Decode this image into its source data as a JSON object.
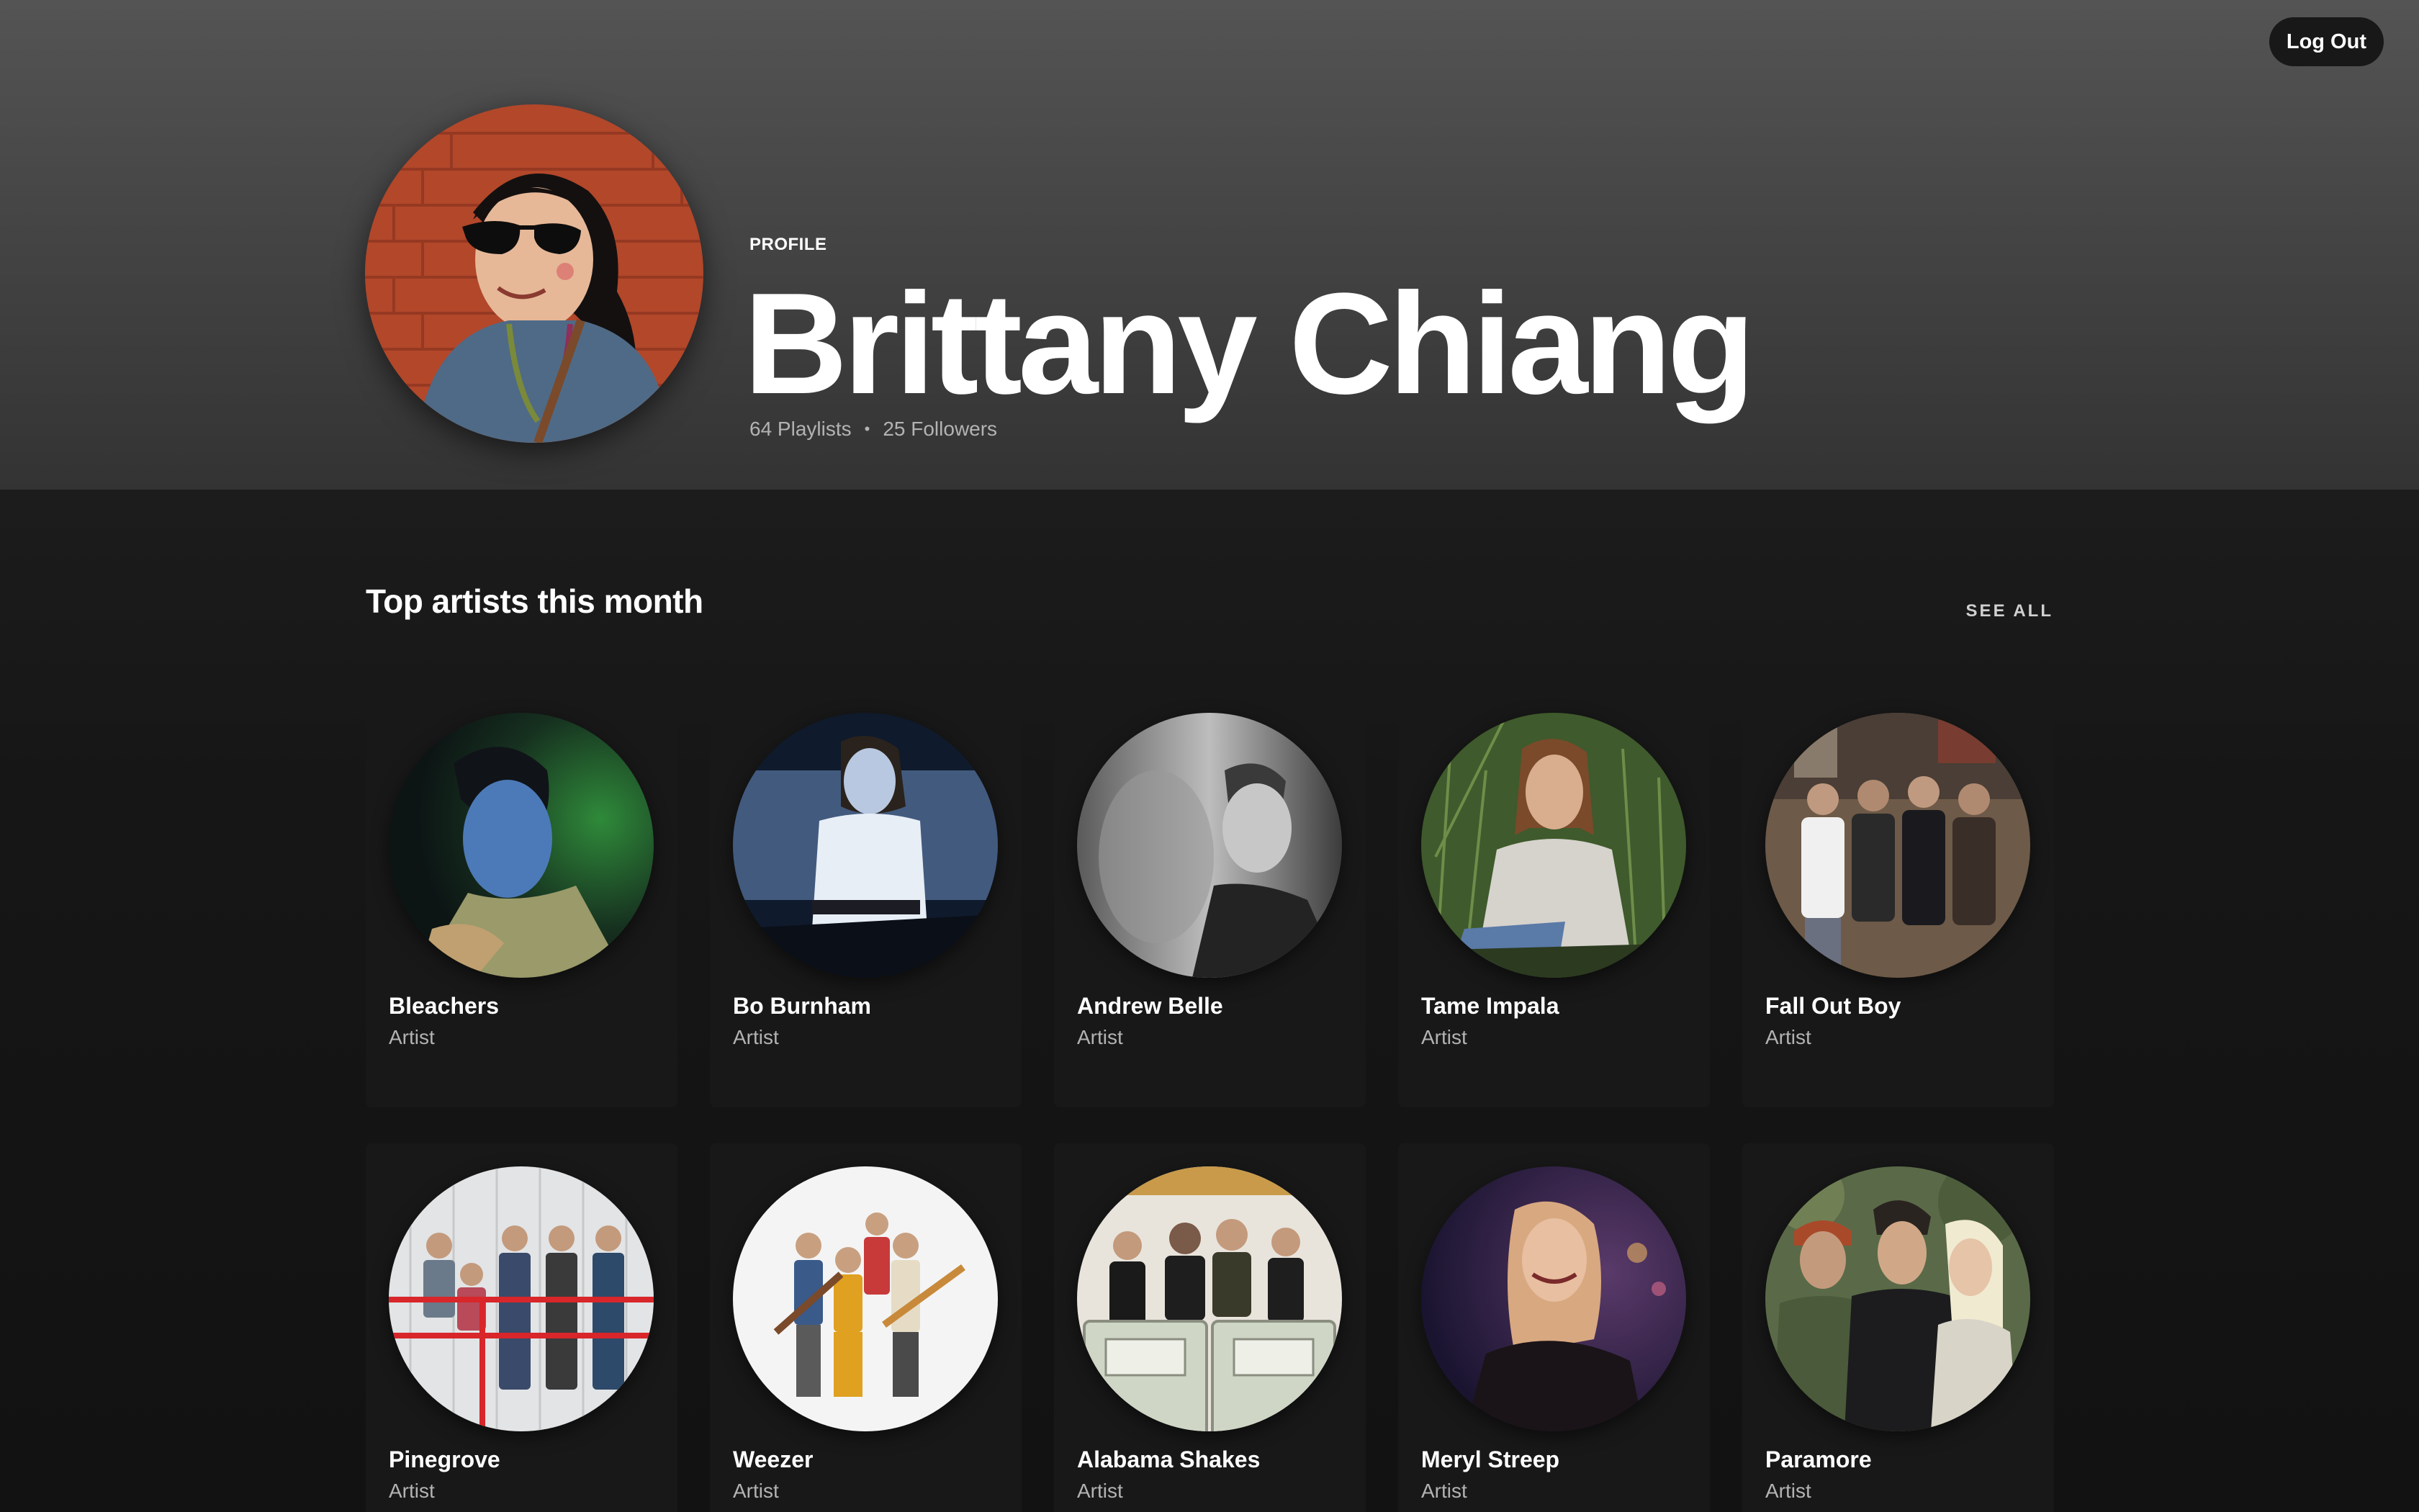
{
  "header": {
    "logout_label": "Log Out",
    "profile_label": "PROFILE",
    "name": "Brittany Chiang",
    "playlists": "64 Playlists",
    "separator": "•",
    "followers": "25 Followers"
  },
  "section": {
    "title": "Top artists this month",
    "see_all": "SEE ALL"
  },
  "artists": [
    {
      "name": "Bleachers",
      "type": "Artist"
    },
    {
      "name": "Bo Burnham",
      "type": "Artist"
    },
    {
      "name": "Andrew Belle",
      "type": "Artist"
    },
    {
      "name": "Tame Impala",
      "type": "Artist"
    },
    {
      "name": "Fall Out Boy",
      "type": "Artist"
    },
    {
      "name": "Pinegrove",
      "type": "Artist"
    },
    {
      "name": "Weezer",
      "type": "Artist"
    },
    {
      "name": "Alabama Shakes",
      "type": "Artist"
    },
    {
      "name": "Meryl Streep",
      "type": "Artist"
    },
    {
      "name": "Paramore",
      "type": "Artist"
    }
  ]
}
